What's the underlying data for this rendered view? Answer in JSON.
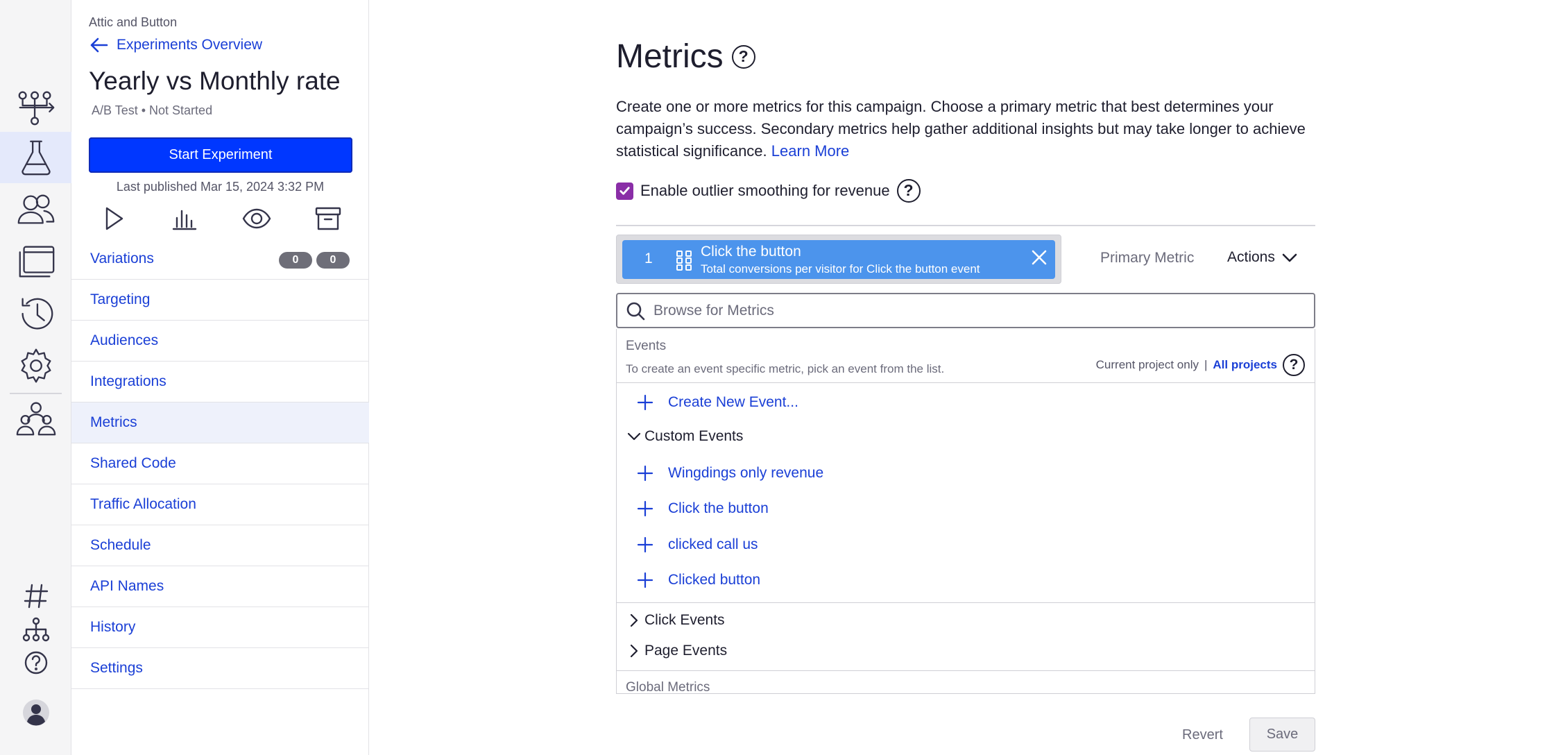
{
  "rail": {
    "icons": [
      "flows-icon",
      "flask-icon",
      "users-icon",
      "windows-icon",
      "history-icon",
      "gear-icon",
      "team-icon",
      "hash-icon",
      "hierarchy-icon",
      "help-icon",
      "profile-avatar"
    ]
  },
  "sidebar": {
    "project": "Attic and Button",
    "back_label": "Experiments Overview",
    "experiment_title": "Yearly vs Monthly rate",
    "experiment_type": "A/B Test",
    "experiment_status": "Not Started",
    "start_button": "Start Experiment",
    "last_published": "Last published Mar 15, 2024 3:32 PM",
    "tool_icons": [
      "play-icon",
      "results-icon",
      "preview-icon",
      "archive-icon"
    ],
    "variations_counts": [
      "0",
      "0"
    ],
    "nav": [
      {
        "label": "Variations"
      },
      {
        "label": "Targeting"
      },
      {
        "label": "Audiences"
      },
      {
        "label": "Integrations"
      },
      {
        "label": "Metrics"
      },
      {
        "label": "Shared Code"
      },
      {
        "label": "Traffic Allocation"
      },
      {
        "label": "Schedule"
      },
      {
        "label": "API Names"
      },
      {
        "label": "History"
      },
      {
        "label": "Settings"
      }
    ],
    "active_item": "Metrics"
  },
  "main": {
    "title": "Metrics",
    "help_glyph": "?",
    "intro": "Create one or more metrics for this campaign. Choose a primary metric that best determines your campaign’s success. Secondary metrics help gather additional insights but may take longer to achieve statistical significance.",
    "learn_more": "Learn More",
    "outlier_label": "Enable outlier smoothing for revenue",
    "outlier_checked": true,
    "metric": {
      "index": "1",
      "name": "Click the button",
      "description": "Total conversions per visitor for Click the button event"
    },
    "primary_label": "Primary Metric",
    "actions_label": "Actions",
    "search_placeholder": "Browse for Metrics",
    "events": {
      "heading": "Events",
      "subtext": "To create an event specific metric, pick an event from the list.",
      "scope_current": "Current project only",
      "scope_separator": "|",
      "scope_all": "All projects",
      "create_new": "Create New Event...",
      "custom_group": "Custom Events",
      "custom_items": [
        "Wingdings only revenue",
        "Click the button",
        "clicked call us",
        "Clicked button"
      ],
      "click_group": "Click Events",
      "page_group": "Page Events",
      "global_heading": "Global Metrics"
    },
    "revert_label": "Revert",
    "save_label": "Save"
  },
  "colors": {
    "accent": "#0037ff",
    "link": "#1a3fd6",
    "metric_card": "#4c94ec",
    "checkbox": "#8a2ea7",
    "active_nav": "#eef1fb"
  }
}
